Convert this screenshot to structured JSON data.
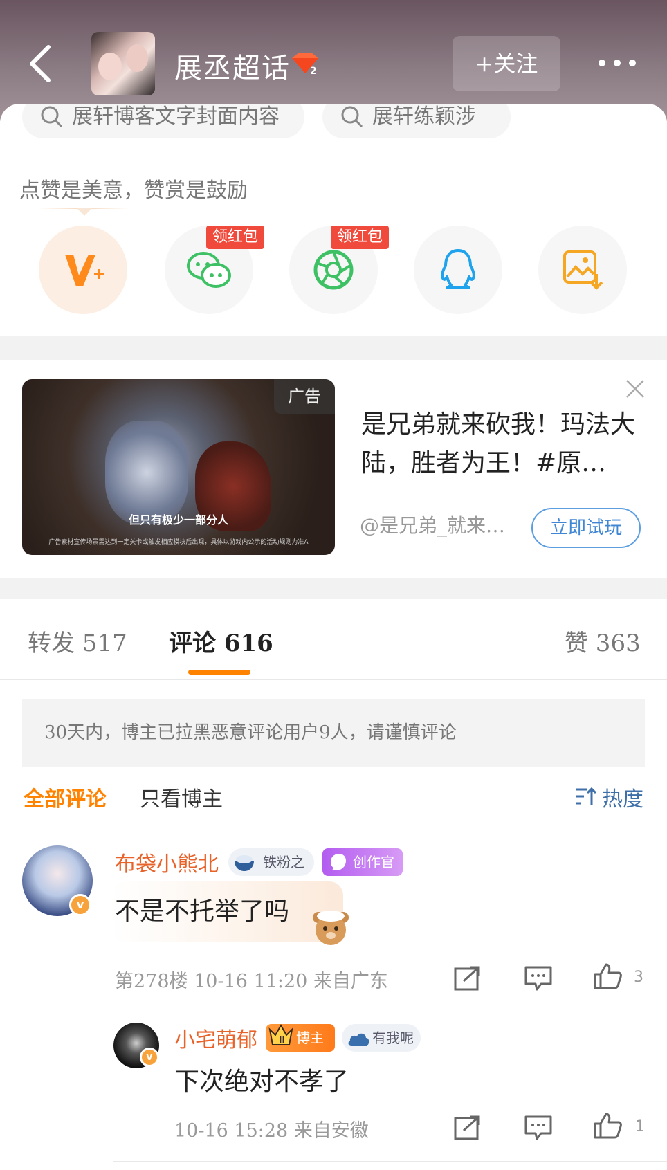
{
  "header": {
    "title": "展丞超话",
    "rank_level": "2",
    "follow_label": "+关注"
  },
  "search_pills": [
    {
      "text": "展轩博客文字封面内容"
    },
    {
      "text": "展轩练颖涉"
    }
  ],
  "reward": {
    "caption": "点赞是美意，赞赏是鼓励",
    "share_options": [
      {
        "icon": "vplus-icon",
        "tag": ""
      },
      {
        "icon": "wechat-icon",
        "tag": "领红包"
      },
      {
        "icon": "moments-icon",
        "tag": "领红包"
      },
      {
        "icon": "qq-icon",
        "tag": ""
      },
      {
        "icon": "save-image-icon",
        "tag": ""
      }
    ]
  },
  "ad": {
    "tag": "广告",
    "subtitle": "但只有极少一部分人",
    "fine_print": "广告素材宣传场景需达到一定关卡或触发相应模块后出现，具体以游戏内公示的活动规则为准A",
    "title": "是兄弟就来砍我！玛法大陆，胜者为王！#原…",
    "author": "@是兄弟_就来…",
    "cta": "立即试玩"
  },
  "tabs": [
    {
      "label": "转发 517"
    },
    {
      "label": "评论 616"
    },
    {
      "label": "赞 363"
    }
  ],
  "notice": "30天内，博主已拉黑恶意评论用户9人，请谨慎评论",
  "filters": {
    "all": "全部评论",
    "author_only": "只看博主",
    "sort": "热度"
  },
  "comment": {
    "user": "布袋小熊北",
    "fan_badge": "铁粉之女",
    "creator_badge": "创作官",
    "text": "不是不托举了吗",
    "meta": "第278楼  10-16 11:20  来自广东",
    "likes": "3"
  },
  "reply": {
    "user": "小宅萌郁",
    "author_badge": "博主",
    "fan_badge": "有我呢",
    "text": "下次绝对不孝了",
    "meta": "10-16 15:28  来自安徽",
    "likes": "1"
  },
  "colors": {
    "accent": "#ff8200",
    "username": "#e8632a",
    "link_blue": "#3f86d4",
    "red_tag": "#f04a3c"
  }
}
